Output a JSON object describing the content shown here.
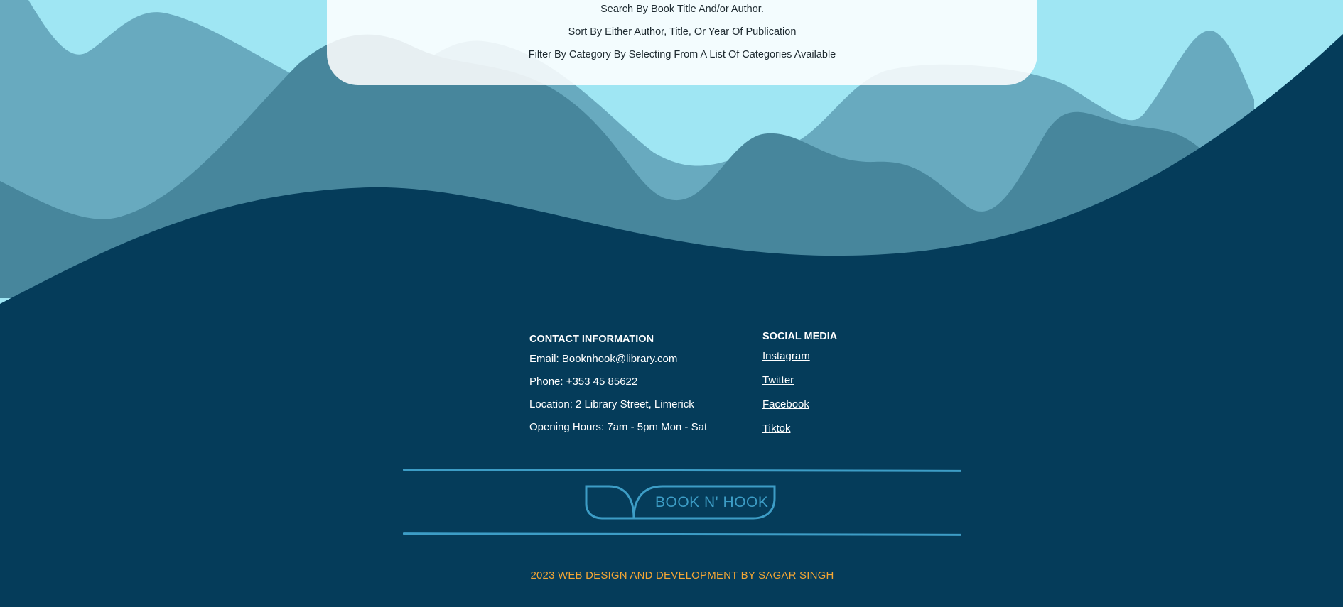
{
  "features": {
    "search": "Search By Book Title And/or Author.",
    "sort": "Sort By Either Author, Title, Or Year Of Publication",
    "filter": "Filter By Category By Selecting From A List Of Categories Available"
  },
  "contact": {
    "heading": "CONTACT INFORMATION",
    "email": "Email:  Booknhook@library.com",
    "phone": "Phone: +353 45 85622",
    "location": "Location: 2 Library Street, Limerick",
    "hours": "Opening Hours: 7am - 5pm Mon - Sat"
  },
  "social": {
    "heading": "SOCIAL MEDIA",
    "links": [
      "Instagram",
      "Twitter",
      "Facebook",
      "Tiktok"
    ]
  },
  "logo": {
    "text": "BOOK N' HOOK"
  },
  "credit": "2023 WEB DESIGN AND DEVELOPMENT BY SAGAR SINGH",
  "colors": {
    "sky": "#9fe6f3",
    "wave_light": "#68aabf",
    "wave_mid": "#47869c",
    "footer_bg": "#053c5a",
    "accent_blue": "#3d9dc6",
    "credit_orange": "#f4a634"
  }
}
